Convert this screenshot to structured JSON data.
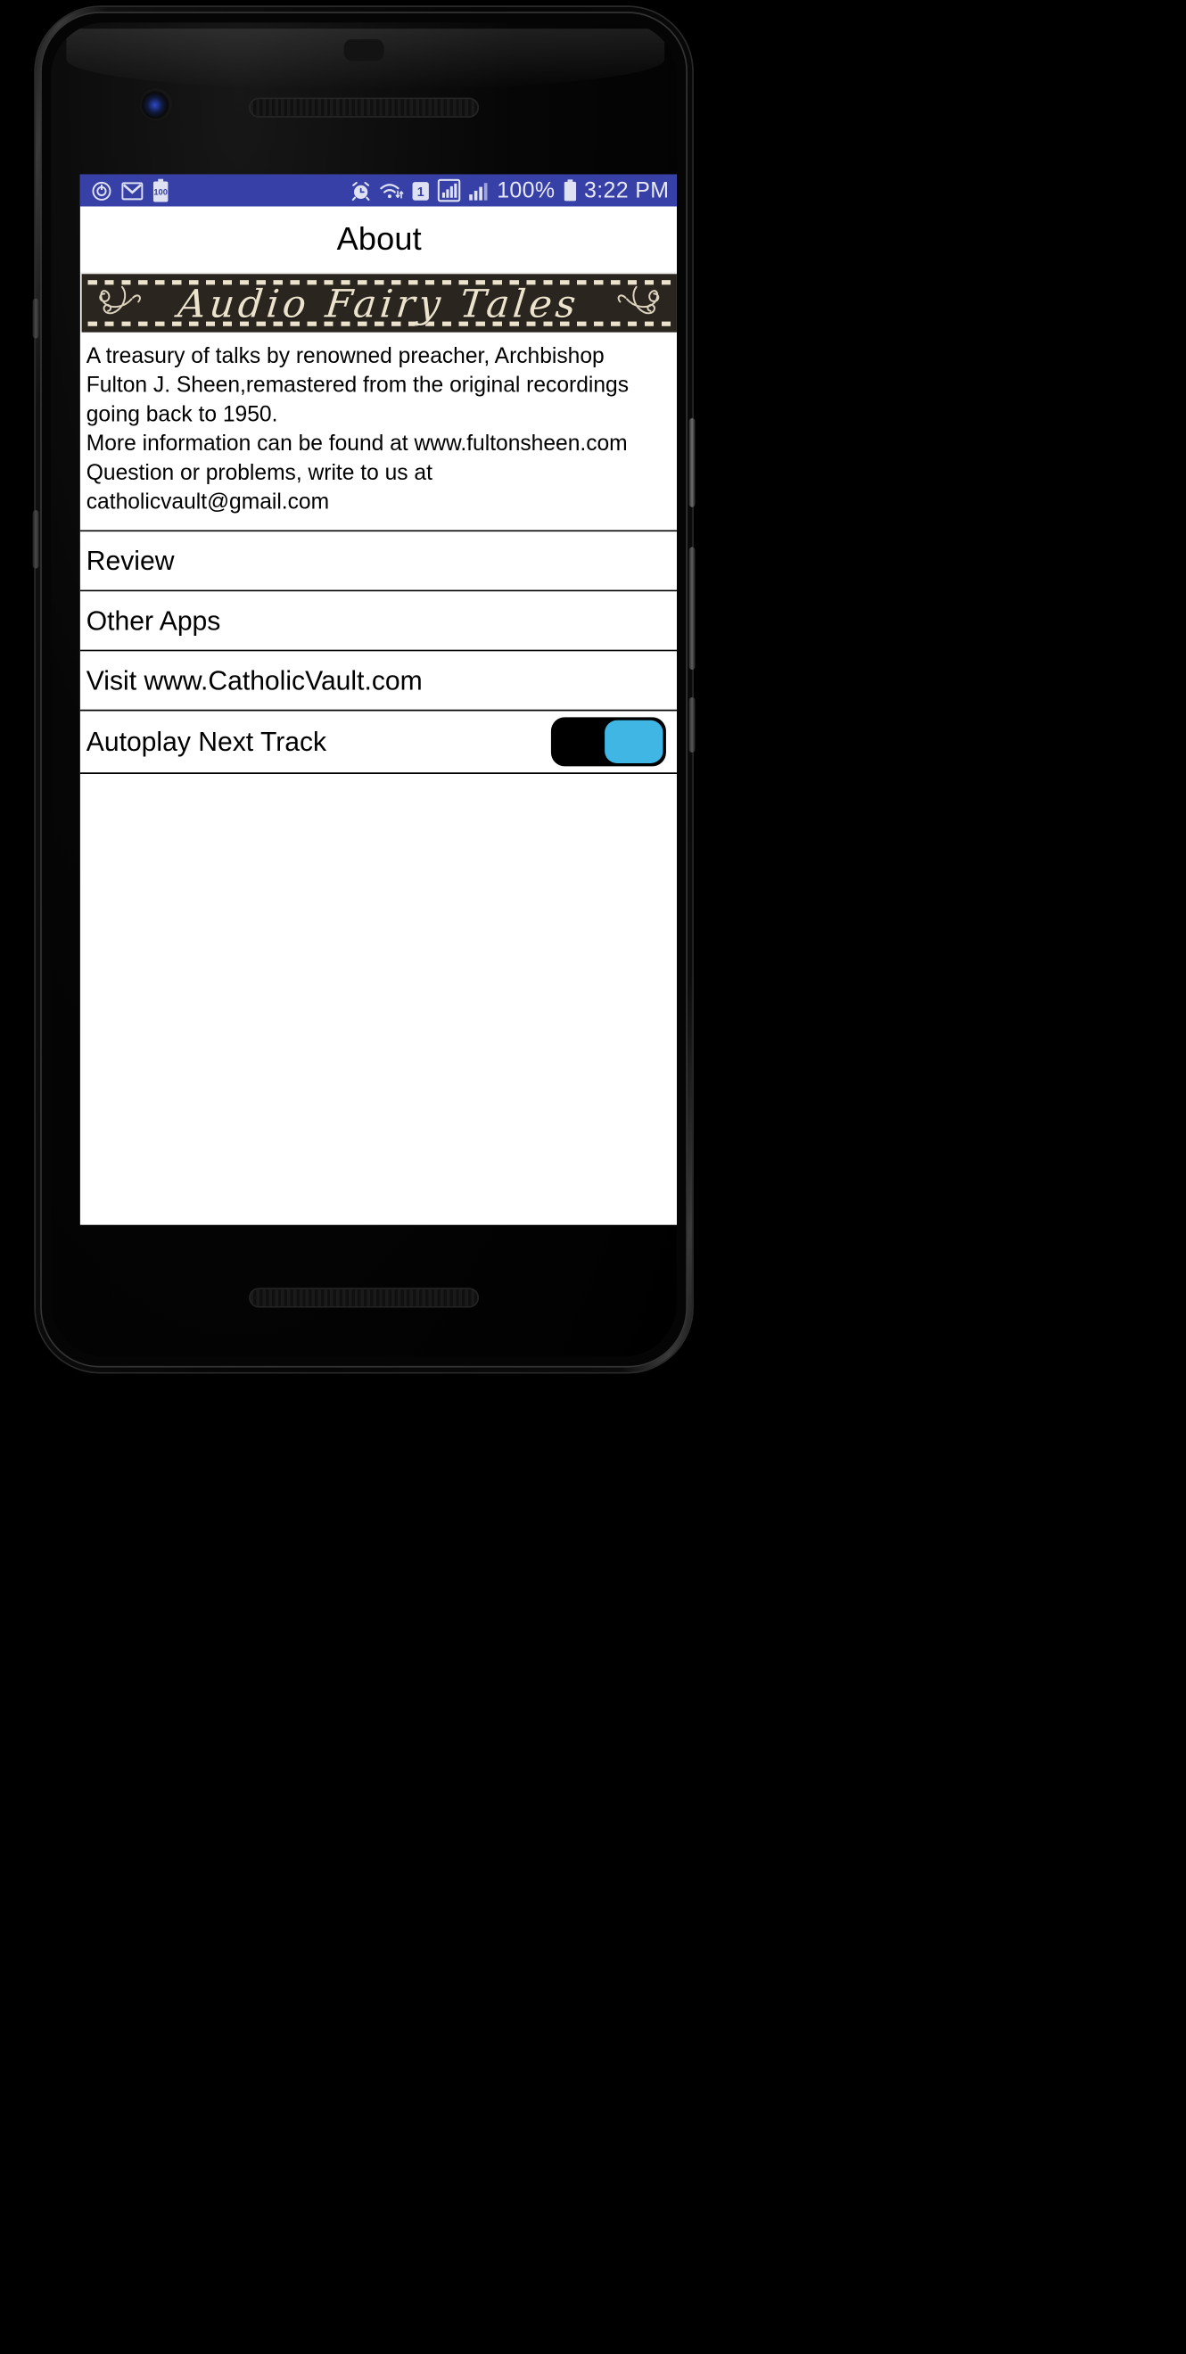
{
  "status_bar": {
    "background_color": "#3740a6",
    "left_icons": [
      {
        "name": "power-saver-icon",
        "glyph": "power"
      },
      {
        "name": "gmail-icon",
        "glyph": "M"
      },
      {
        "name": "battery-100-icon",
        "glyph": "100"
      }
    ],
    "right_icons": [
      {
        "name": "alarm-clock-icon"
      },
      {
        "name": "wifi-transfer-icon"
      },
      {
        "name": "sim-1-icon",
        "label": "1"
      },
      {
        "name": "signal-bars-boxed-icon"
      },
      {
        "name": "signal-bars-icon"
      }
    ],
    "battery_percent": "100%",
    "time": "3:22 PM"
  },
  "action_bar": {
    "title": "About"
  },
  "banner": {
    "title": "Audio Fairy Tales",
    "background_color": "#2b2520",
    "text_color": "#ece3cd"
  },
  "description": {
    "lines": [
      "A treasury of talks by renowned preacher, Archbishop",
      "Fulton J. Sheen,remastered from the original recordings",
      "going back to 1950.",
      "More information can be found at www.fultonsheen.com",
      "Question or problems, write to us at",
      "catholicvault@gmail.com"
    ]
  },
  "list": {
    "items": [
      {
        "label": "Review",
        "type": "link"
      },
      {
        "label": "Other Apps",
        "type": "link"
      },
      {
        "label": "Visit www.CatholicVault.com",
        "type": "link"
      }
    ],
    "toggle_row": {
      "label": "Autoplay Next Track",
      "state": "on",
      "track_color": "#000000",
      "thumb_color": "#3fb6e4"
    }
  }
}
